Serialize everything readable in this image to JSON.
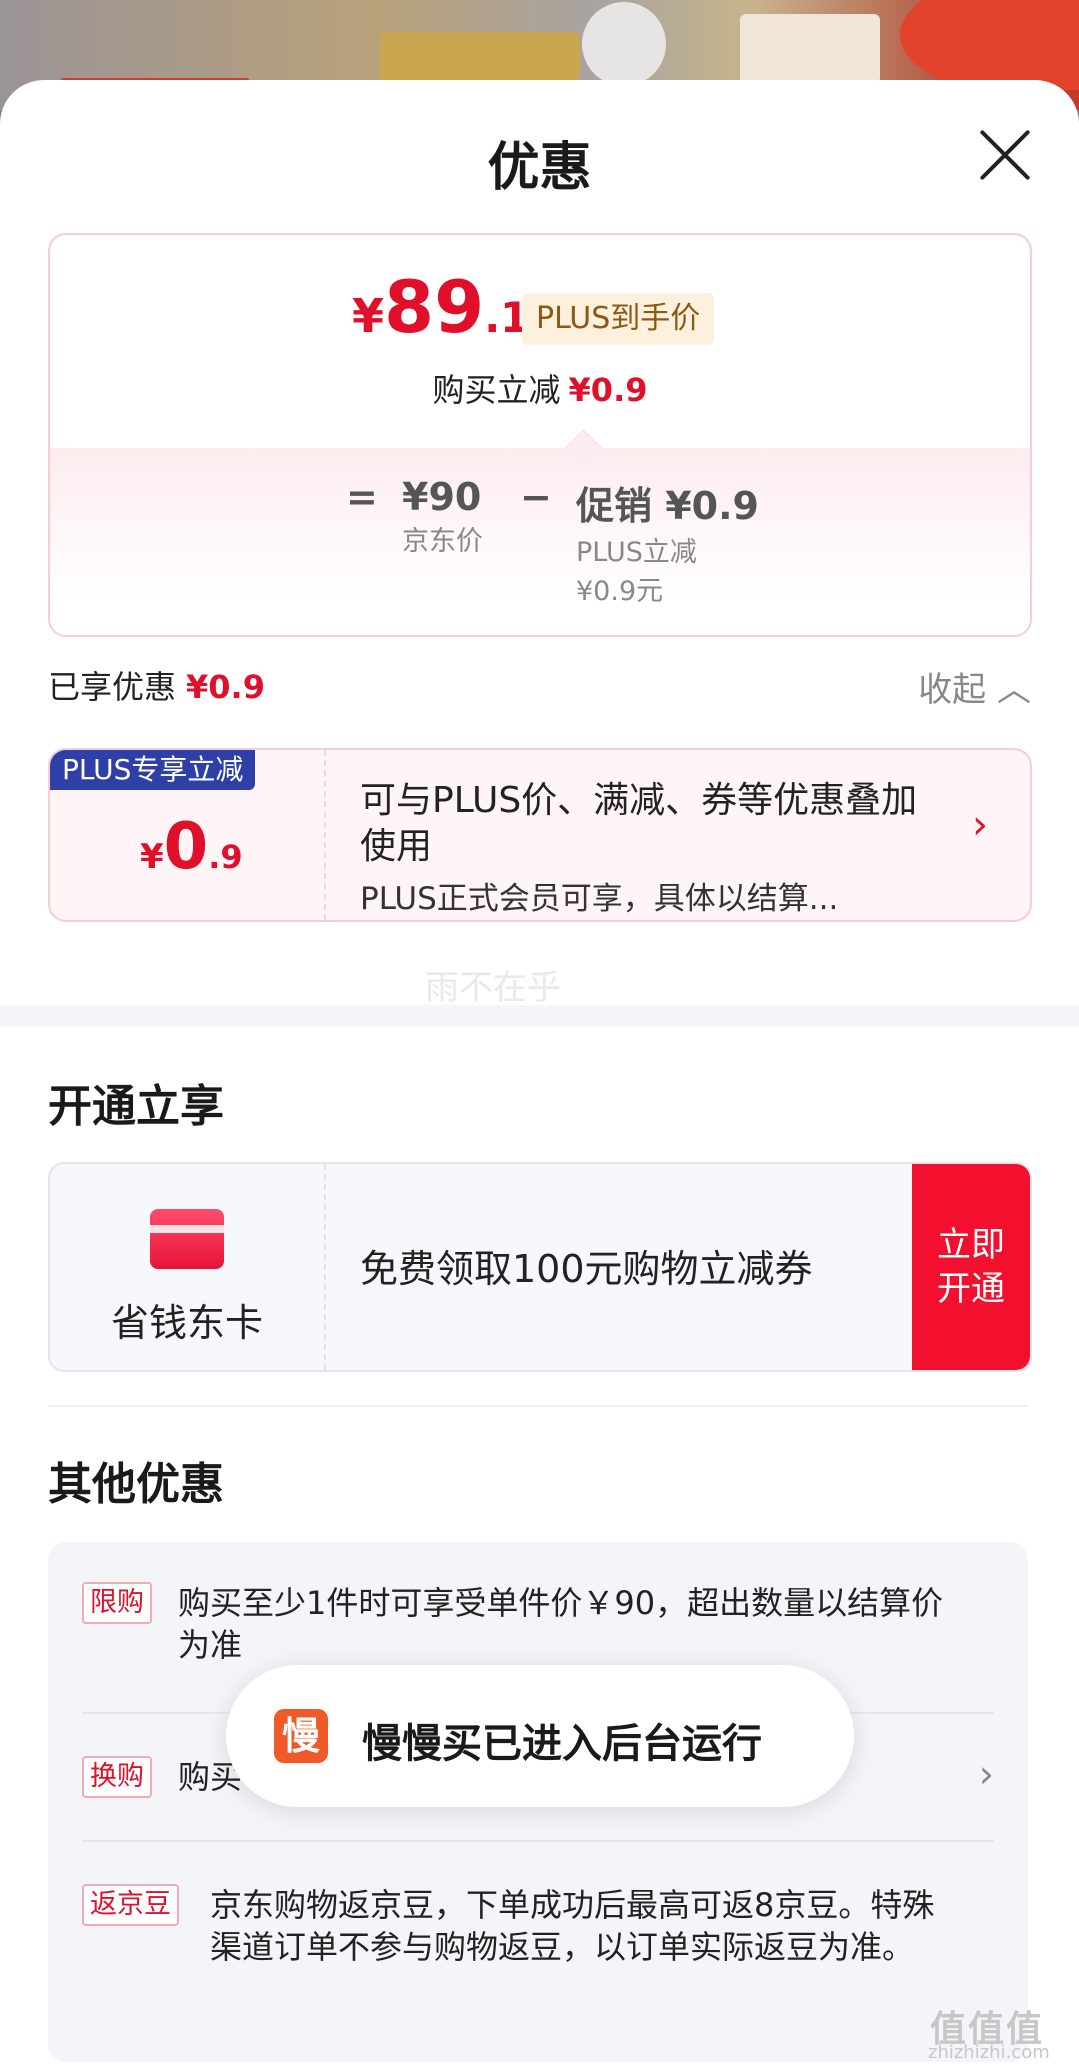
{
  "sheet": {
    "title": "优惠"
  },
  "price": {
    "currency": "¥",
    "integer": "89",
    "decimal": ".1",
    "tag": "PLUS到手价",
    "reduce_label": "购买立减",
    "reduce_value": "¥0.9"
  },
  "formula": {
    "eq": "=",
    "jd_price": "¥90",
    "jd_price_label": "京东价",
    "minus": "−",
    "promo": "促销 ¥0.9",
    "promo_label": "PLUS立减",
    "promo_sub": "¥0.9元"
  },
  "enjoyed": {
    "label": "已享优惠",
    "value": "¥0.9",
    "collapse": "收起 ︿"
  },
  "plus_offer": {
    "flag": "PLUS专享立减",
    "currency": "¥",
    "integer": "0",
    "decimal": ".9",
    "desc": "可与PLUS价、满减、券等优惠叠加使用",
    "sub": "PLUS正式会员可享，具体以结算..."
  },
  "watermark": "雨不在乎",
  "open": {
    "section_title": "开通立享",
    "card_name": "省钱东卡",
    "coupon": "免费领取100元购物立减券",
    "button": "立即\n开通"
  },
  "other": {
    "section_title": "其他优惠",
    "rows": [
      {
        "tag": "限购",
        "text": "购买至少1件时可享受单件价￥90，超出数量以结算价为准"
      },
      {
        "tag": "换购",
        "text": "购买"
      },
      {
        "tag": "返京豆",
        "text": "京东购物返京豆，下单成功后最高可返8京豆。特殊渠道订单不参与购物返豆，以订单实际返豆为准。"
      }
    ]
  },
  "toast": {
    "icon_char": "慢",
    "message": "慢慢买已进入后台运行"
  },
  "site_mark": {
    "logo": "值值值",
    "url": "zhizhizhi.com"
  },
  "colors": {
    "accent": "#e0102b",
    "plus_blue": "#2e40a8",
    "button_red": "#f2102e"
  }
}
